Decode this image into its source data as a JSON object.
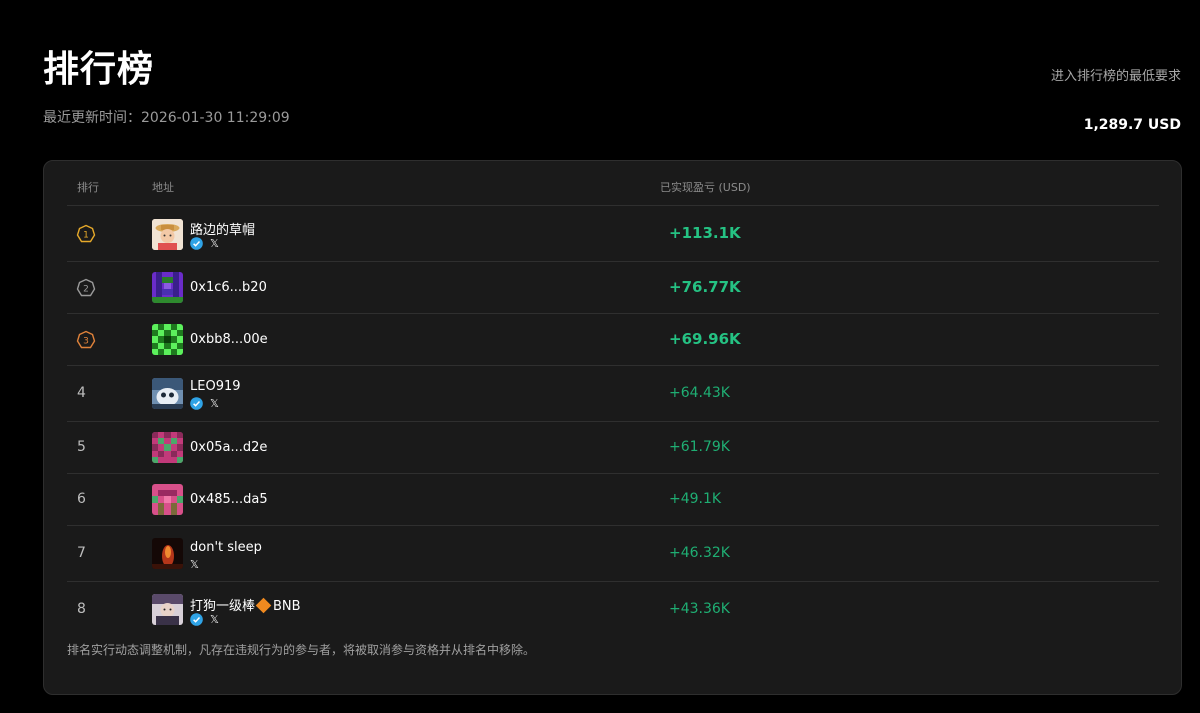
{
  "header": {
    "title": "排行榜",
    "updated": "最近更新时间：2026-01-30 11:29:09",
    "requirement_label": "进入排行榜的最低要求",
    "requirement_value": "1,289.7 USD"
  },
  "table": {
    "columns": {
      "rank": "排行",
      "address": "地址",
      "pnl": "已实现盈亏 (USD)"
    },
    "rows": [
      {
        "rank": "1",
        "badge": "gold",
        "name": "路边的草帽",
        "verified": true,
        "x": true,
        "pnl": "+113.1K"
      },
      {
        "rank": "2",
        "badge": "silver",
        "name": "0x1c6...b20",
        "verified": false,
        "x": false,
        "pnl": "+76.77K"
      },
      {
        "rank": "3",
        "badge": "bronze",
        "name": "0xbb8...00e",
        "verified": false,
        "x": false,
        "pnl": "+69.96K"
      },
      {
        "rank": "4",
        "badge": "",
        "name": "LEO919",
        "verified": true,
        "x": true,
        "pnl": "+64.43K"
      },
      {
        "rank": "5",
        "badge": "",
        "name": "0x05a...d2e",
        "verified": false,
        "x": false,
        "pnl": "+61.79K"
      },
      {
        "rank": "6",
        "badge": "",
        "name": "0x485...da5",
        "verified": false,
        "x": false,
        "pnl": "+49.1K"
      },
      {
        "rank": "7",
        "badge": "",
        "name": "don't sleep",
        "verified": false,
        "x": true,
        "pnl": "+46.32K"
      },
      {
        "rank": "8",
        "badge": "",
        "name_prefix": "打狗一级棒",
        "name_suffix": "BNB",
        "verified": true,
        "x": true,
        "pnl": "+43.36K"
      }
    ]
  },
  "icons": {
    "verified": "verified-badge-icon",
    "x": "x-logo-icon",
    "x_glyph": "𝕏",
    "diamond": "orange-diamond-icon"
  },
  "colors": {
    "background": "#000000",
    "card": "#1a1a1a",
    "profit_green": "#1fae73",
    "gold": "#e6a92a",
    "silver": "#9a9a9a",
    "bronze": "#e0823a",
    "verified_blue": "#2fa3e6"
  },
  "footnote": "排名实行动态调整机制，凡存在违规行为的参与者，将被取消参与资格并从排名中移除。"
}
